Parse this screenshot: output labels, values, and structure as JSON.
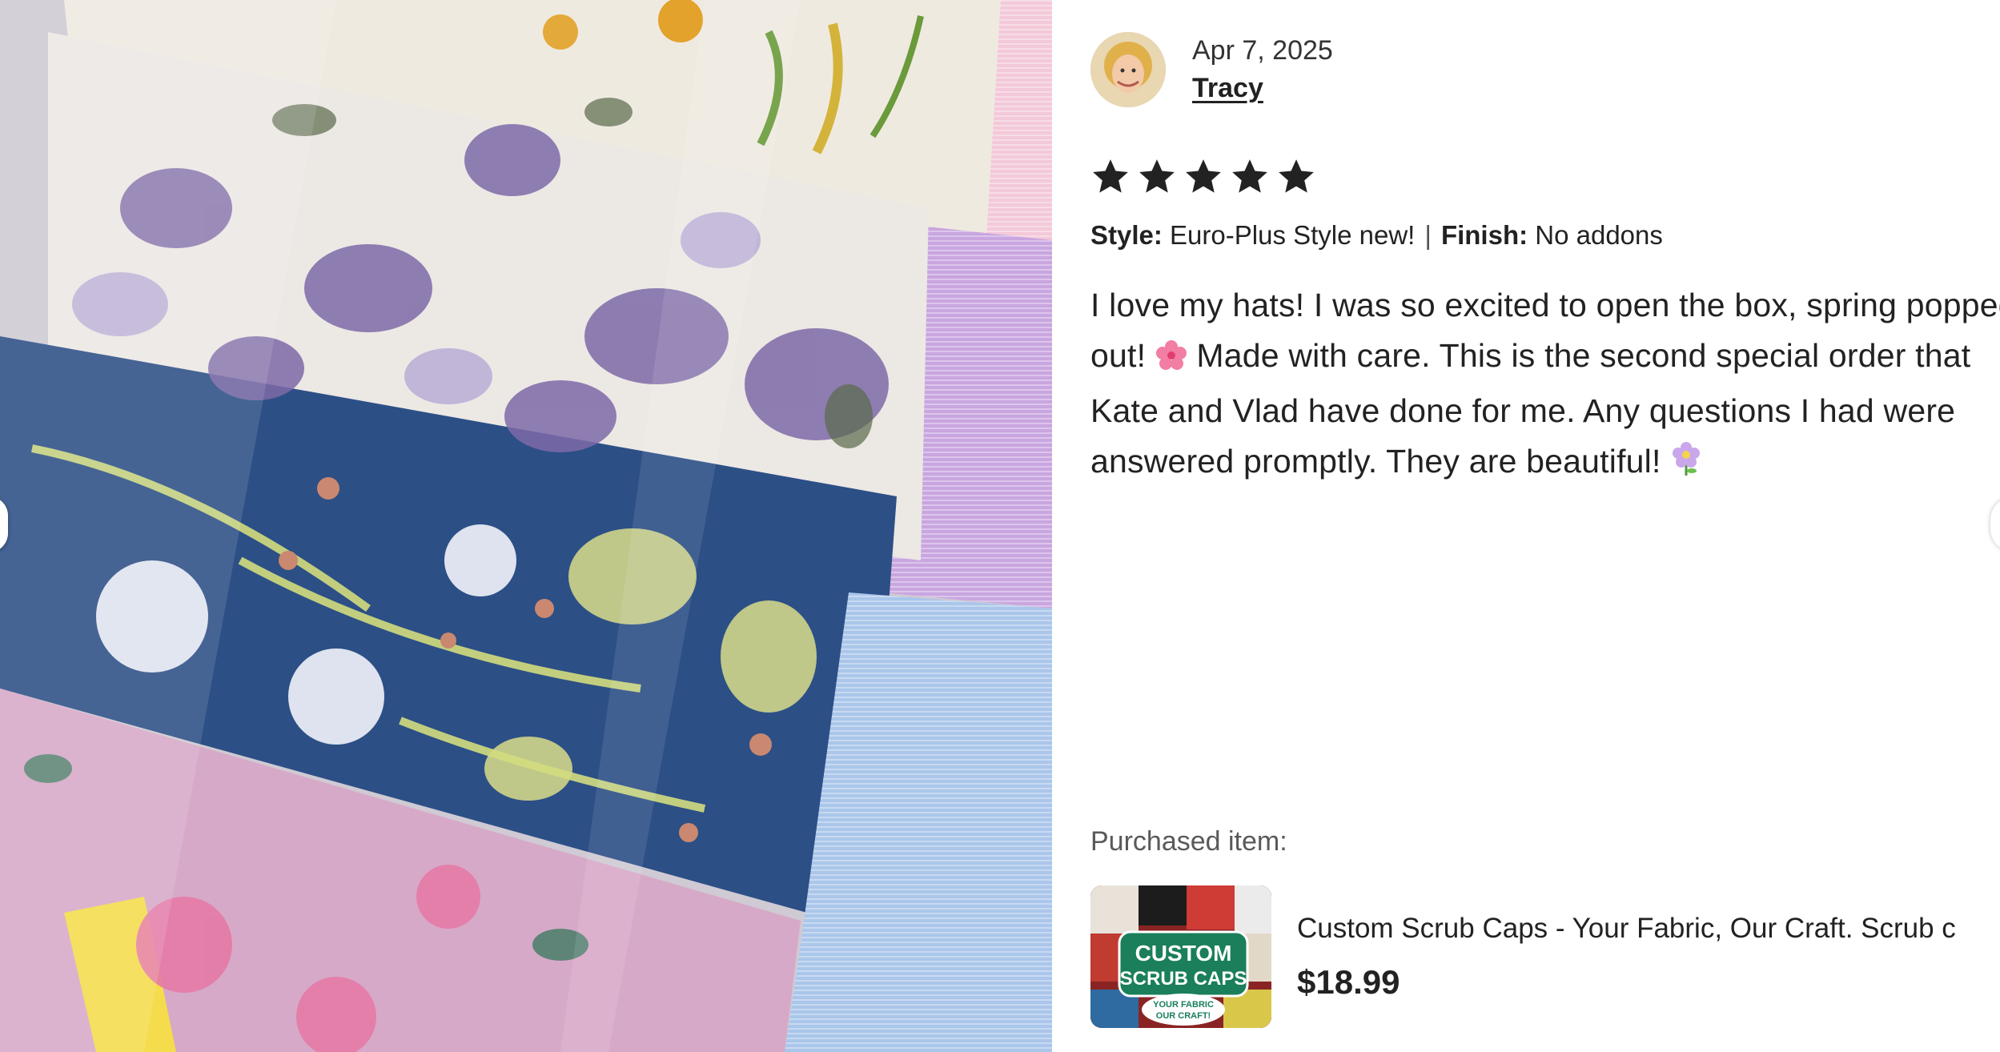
{
  "review": {
    "date": "Apr 7, 2025",
    "reviewer_name": "Tracy",
    "rating": 5,
    "star_icon": "star-icon",
    "style_label": "Style:",
    "style_value": "Euro-Plus Style new!",
    "separator": "|",
    "finish_label": "Finish:",
    "finish_value": "No addons",
    "text_part1": "I love my hats! I was so excited to open the box, spring popped out! ",
    "text_part2": "Made with care. This is the second special order that Kate and Vlad have done for me. Any questions I had were answered promptly. They are beautiful!",
    "emoji_1": "cherry-blossom-icon",
    "emoji_2": "blossom-icon"
  },
  "purchase": {
    "label": "Purchased item:",
    "item_title": "Custom Scrub Caps - Your Fabric, Our Craft. Scrub c",
    "price": "$18.99",
    "thumb_text_line1": "CUSTOM",
    "thumb_text_line2": "SCRUB CAPS",
    "thumb_badge_line1": "YOUR FABRIC",
    "thumb_badge_line2": "OUR CRAFT!"
  },
  "colors": {
    "star": "#222222",
    "text": "#222222",
    "muted": "#595959",
    "thumb_green": "#1a7f5a"
  }
}
